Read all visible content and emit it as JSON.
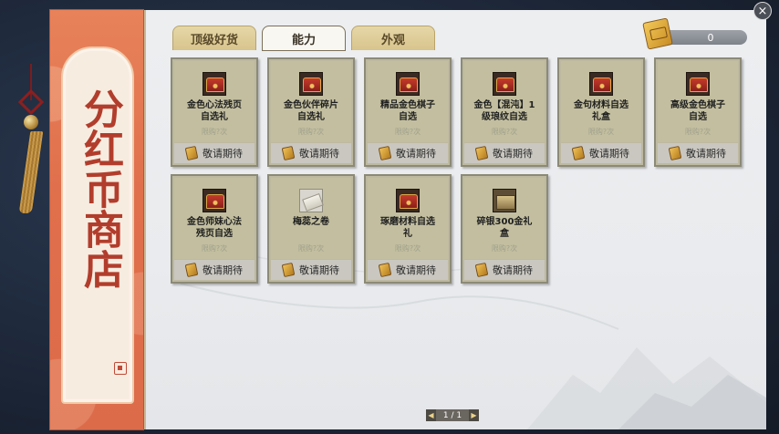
{
  "shop": {
    "title": "分红币商店",
    "tabs": [
      {
        "label": "顶级好货",
        "active": false
      },
      {
        "label": "能力",
        "active": true
      },
      {
        "label": "外观",
        "active": false
      }
    ],
    "currency": {
      "value": "0",
      "icon": "coin-ticket-icon"
    },
    "close_icon": "×",
    "items": [
      {
        "name": "金色心法残页\n自选礼",
        "limit": "限购?次",
        "price_label": "敬请期待",
        "icon": "chest"
      },
      {
        "name": "金色伙伴碎片\n自选礼",
        "limit": "限购?次",
        "price_label": "敬请期待",
        "icon": "chest"
      },
      {
        "name": "精品金色棋子\n自选",
        "limit": "限购?次",
        "price_label": "敬请期待",
        "icon": "chest"
      },
      {
        "name": "金色【混沌】1\n级琅纹自选",
        "limit": "限购?次",
        "price_label": "敬请期待",
        "icon": "chest"
      },
      {
        "name": "金句材料自选\n礼盒",
        "limit": "限购?次",
        "price_label": "敬请期待",
        "icon": "chest"
      },
      {
        "name": "高级金色棋子\n自选",
        "limit": "限购?次",
        "price_label": "敬请期待",
        "icon": "chest"
      },
      {
        "name": "金色师妹心法\n残页自选",
        "limit": "限购?次",
        "price_label": "敬请期待",
        "icon": "chest"
      },
      {
        "name": "梅蕊之卷",
        "limit": "限购?次",
        "price_label": "敬请期待",
        "icon": "scroll"
      },
      {
        "name": "琢磨材料自选\n礼",
        "limit": "限购?次",
        "price_label": "敬请期待",
        "icon": "chest"
      },
      {
        "name": "碎银300金礼\n盒",
        "limit": "限购?次",
        "price_label": "敬请期待",
        "icon": "silver"
      }
    ],
    "pager": {
      "text": "1 / 1",
      "prev": "◀",
      "next": "▶"
    }
  }
}
